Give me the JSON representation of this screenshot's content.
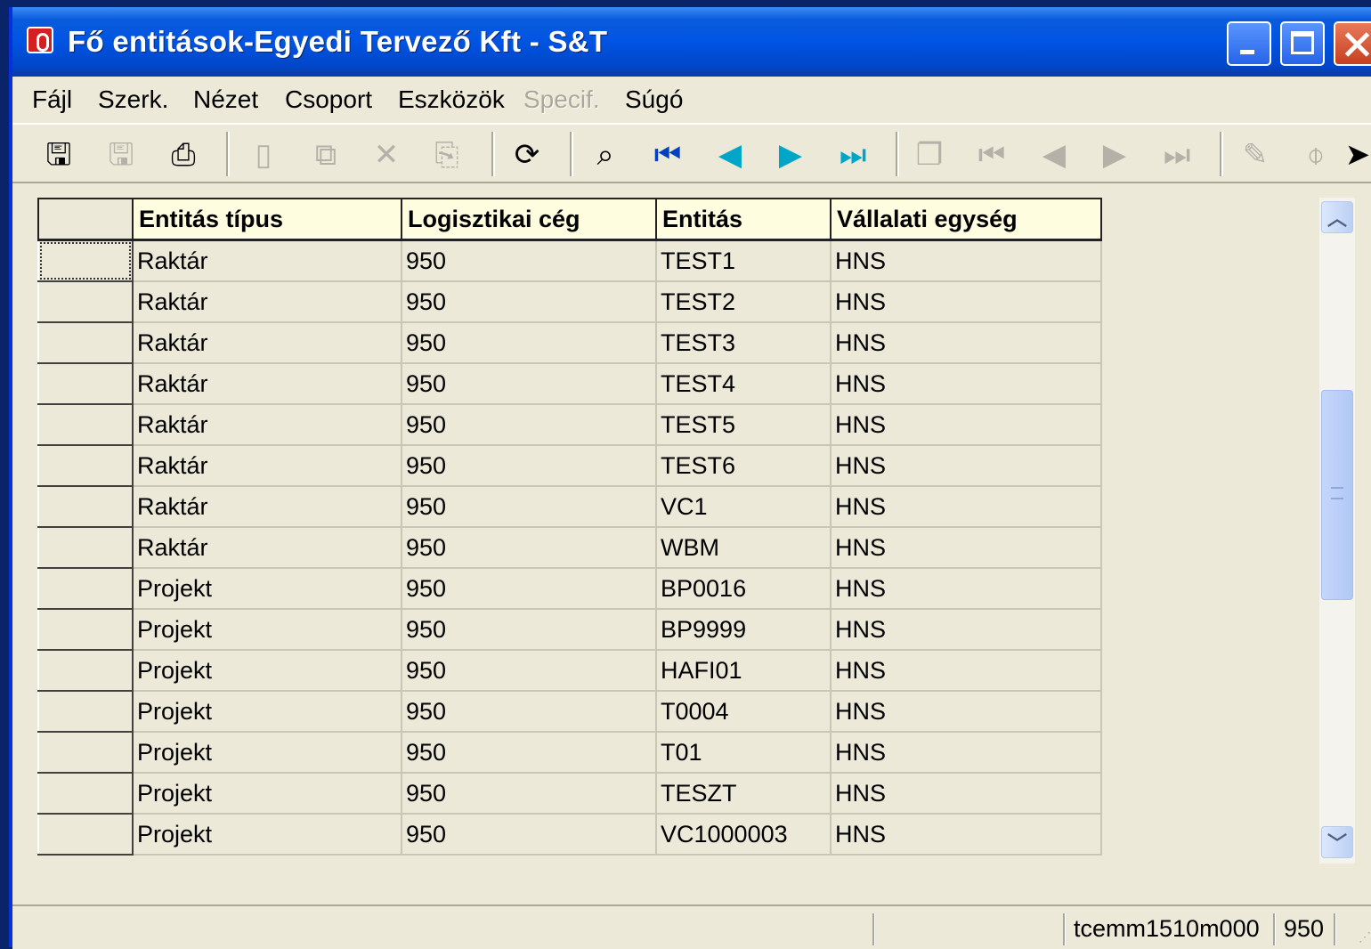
{
  "window": {
    "title": "Fő entitások-Egyedi Tervező  Kft - S&T"
  },
  "menu": [
    {
      "label": "Fájl",
      "enabled": true
    },
    {
      "label": "Szerk.",
      "enabled": true
    },
    {
      "label": "Nézet",
      "enabled": true
    },
    {
      "label": "Csoport",
      "enabled": true
    },
    {
      "label": "Eszközök",
      "enabled": true
    },
    {
      "label": "Specif.",
      "enabled": false
    },
    {
      "label": "Súgó",
      "enabled": true
    }
  ],
  "toolbar": {
    "icons": [
      "save-close-icon",
      "save-icon",
      "print-icon",
      "new-icon",
      "copy-icon",
      "delete-icon",
      "duplicate-icon",
      "refresh-icon",
      "find-icon",
      "first-record-icon",
      "previous-record-icon",
      "next-record-icon",
      "last-record-icon",
      "group-icon",
      "first-group-icon",
      "previous-group-icon",
      "next-group-icon",
      "last-group-icon",
      "text-icon",
      "attachment-icon",
      "pointer-icon"
    ]
  },
  "grid": {
    "columns": [
      "Entitás típus",
      "Logisztikai cég",
      "Entitás",
      "Vállalati egység"
    ],
    "rows": [
      [
        "Raktár",
        "950",
        "TEST1",
        "HNS"
      ],
      [
        "Raktár",
        "950",
        "TEST2",
        "HNS"
      ],
      [
        "Raktár",
        "950",
        "TEST3",
        "HNS"
      ],
      [
        "Raktár",
        "950",
        "TEST4",
        "HNS"
      ],
      [
        "Raktár",
        "950",
        "TEST5",
        "HNS"
      ],
      [
        "Raktár",
        "950",
        "TEST6",
        "HNS"
      ],
      [
        "Raktár",
        "950",
        "VC1",
        "HNS"
      ],
      [
        "Raktár",
        "950",
        "WBM",
        "HNS"
      ],
      [
        "Projekt",
        "950",
        "BP0016",
        "HNS"
      ],
      [
        "Projekt",
        "950",
        "BP9999",
        "HNS"
      ],
      [
        "Projekt",
        "950",
        "HAFI01",
        "HNS"
      ],
      [
        "Projekt",
        "950",
        "T0004",
        "HNS"
      ],
      [
        "Projekt",
        "950",
        "T01",
        "HNS"
      ],
      [
        "Projekt",
        "950",
        "TESZT",
        "HNS"
      ],
      [
        "Projekt",
        "950",
        "VC1000003",
        "HNS"
      ]
    ]
  },
  "status": {
    "session": "tcemm1510m000",
    "company": "950"
  }
}
